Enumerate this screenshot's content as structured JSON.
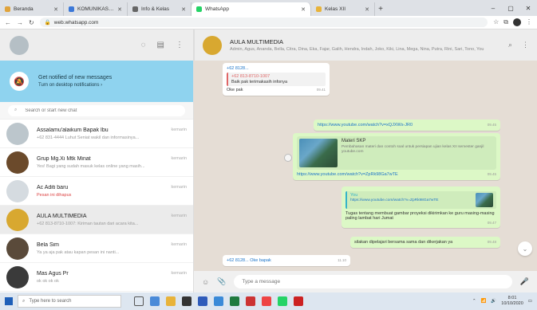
{
  "browser": {
    "tabs": [
      {
        "label": "Beranda",
        "color": "#e0a33b"
      },
      {
        "label": "KOMUNIKASI DAN JARINGAN",
        "color": "#3b78d8"
      },
      {
        "label": "Info & Kelas",
        "color": "#666666"
      },
      {
        "label": "WhatsApp",
        "color": "#25d366",
        "active": true
      },
      {
        "label": "Kelas XII",
        "color": "#e8b33a"
      }
    ],
    "url": "web.whatsapp.com",
    "window_controls": {
      "minimize": "–",
      "maximize": "▢",
      "close": "✕"
    }
  },
  "sidebar": {
    "notification": {
      "title": "Get notified of new messages",
      "subtitle": "Turn on desktop notifications ›"
    },
    "search_placeholder": "Search or start new chat",
    "chats": [
      {
        "name": "Assalamu'alaikum Bapak Ibu",
        "time": "kemarin",
        "preview": "+62 831-4444 Luhut Seniat wakil dan informasinya...",
        "avatar": "#bcc6cc"
      },
      {
        "name": "Grup Mg.Xi Mtk Minat",
        "time": "kemarin",
        "preview": "Yes! Bagi yang sudah masuk kelas online yang masih...",
        "avatar": "#6b4a2b"
      },
      {
        "name": "Ac Aditi baru",
        "time": "kemarin",
        "preview": "Pesan ini dihapus",
        "avatar": "#d5dbe0",
        "preview_red": true
      },
      {
        "name": "AULA MULTIMEDIA",
        "time": "kemarin",
        "preview": "+62 813-8710-1007: Kiriman tautan dari acara kita...",
        "avatar": "#d8a830",
        "selected": true
      },
      {
        "name": "Bela Sim",
        "time": "kemarin",
        "preview": "Ya ya aja pak atau kapan pesan ini nanti...",
        "avatar": "#5a4a3a"
      },
      {
        "name": "Mas Agus Pr",
        "time": "kemarin",
        "preview": "ok ok ok ok",
        "avatar": "#3a3a3a"
      }
    ]
  },
  "conversation": {
    "title": "AULA MULTIMEDIA",
    "subtitle": "Admin, Agus, Ananda, Bella, Citra, Dina, Eka, Fajar, Galih, Hendra, Indah, Joko, Kiki, Lina, Mega, Nina, Putra, Rini, Sari, Tono, You",
    "messages": {
      "m1_sender": "+62 8128...",
      "m1_quote_title": "+62 813-8710-1007",
      "m1_quote_text": "Baik pak terimakasih infonya",
      "m1_text": "Oke pak",
      "m1_time": "09.41",
      "m2_link": "https://www.youtube.com/watch?v=xQJXWs-JR0",
      "m2_time": "09.45",
      "m3_card_title": "Materi SKP",
      "m3_card_desc": "Pembahasan materi dan contoh soal untuk persiapan ujian kelas XII semester ganjil",
      "m3_card_url": "youtube.com",
      "m3_link": "https://www.youtube.com/watch?v=ZpRk98Ga7wTE",
      "m3_time": "09.45",
      "m4_quote_title": "You",
      "m4_quote_text": "https://www.youtube.com/watch?v=ZpRk98Ga7wTE",
      "m4_text": "Tugas tentang membuat gambar proyeksi dikirimkan ke guru masing-masing paling lambat hari Jumat",
      "m4_time": "09.47",
      "m5_text": "silakan dipelajari bersama sama dan dikerjakan ya",
      "m5_time": "09.48",
      "m6_text": "+62 8128... Oke bapak",
      "m6_time": "11.10"
    },
    "compose_placeholder": "Type a message"
  },
  "taskbar": {
    "search_placeholder": "Type here to search",
    "time": "8:01",
    "date": "10/10/2020"
  }
}
